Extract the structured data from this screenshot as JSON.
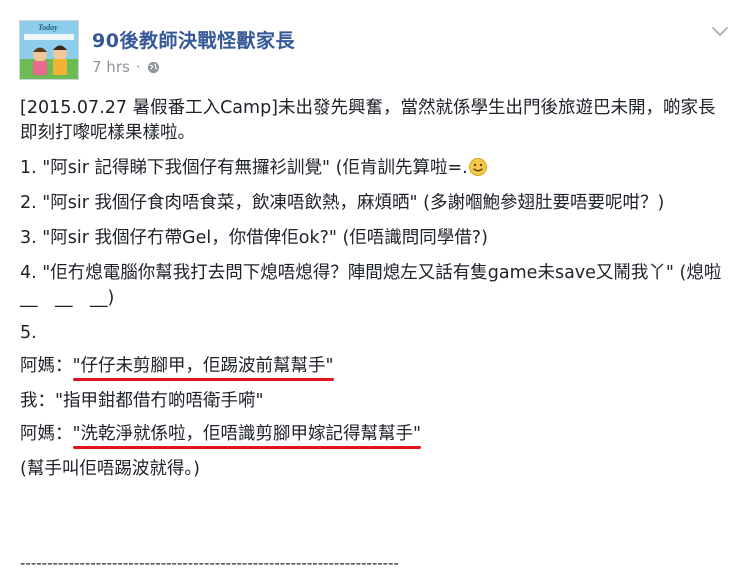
{
  "post": {
    "page_name": "90後教師決戰怪獸家長",
    "timestamp": "7 hrs",
    "separator": "·",
    "avatar_text": "Today",
    "icons": {
      "privacy": "globe-icon",
      "options": "chevron-down-icon",
      "emoji": "smiley-emoji-icon"
    },
    "colors": {
      "name_link": "#365899",
      "meta_gray": "#90949c",
      "underline_red": "#e3141f"
    },
    "paragraphs": {
      "intro": "[2015.07.27 暑假番工入Camp]未出發先興奮，當然就係學生出門後旅遊巴未開，啲家長即刻打嚟呢樣果樣啦。",
      "item1": "1. \"阿sir 記得睇下我個仔有無攞衫訓覺\" (佢肯訓先算啦=.",
      "item1_end": "",
      "item2": "2. \"阿sir 我個仔食肉唔食菜，飲凍唔飲熱，麻煩晒\" (多謝嗰鮑參翅肚要唔要呢咁？)",
      "item3": "3. \"阿sir 我個仔冇帶Gel，你借俾佢ok?\" (佢唔識問同學借?)",
      "item4": "4. \"佢冇熄電腦你幫我打去問下熄唔熄得？陣間熄左又話有隻game未save又鬧我丫\" (熄啦　__　__　__)",
      "item5": "5.",
      "mom1_speaker": "阿媽：",
      "mom1_quote": "\"仔仔未剪腳甲，佢踢波前幫幫手\"",
      "me_line": "我：\"指甲鉗都借冇啲唔衛手嗬\"",
      "mom2_speaker": "阿媽：",
      "mom2_quote": "\"洗乾淨就係啦，佢唔識剪腳甲嫁記得幫幫手\"",
      "closing": "(幫手叫佢唔踢波就得。)",
      "divider": "----------------------------------------------------------------------"
    }
  }
}
